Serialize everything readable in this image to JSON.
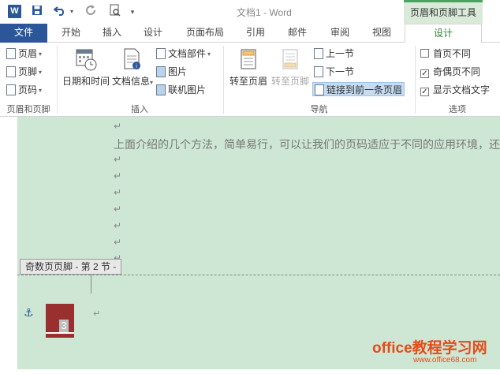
{
  "app": {
    "logo": "W",
    "window_title": "文档1 - Word",
    "context_header": "页眉和页脚工具"
  },
  "quick_access": {
    "save_icon": "save-icon",
    "undo_icon": "undo-icon",
    "redo_icon": "redo-icon",
    "preview_icon": "print-preview-icon",
    "customize_icon": "customize-icon"
  },
  "tabs": {
    "file": "文件",
    "home": "开始",
    "insert": "插入",
    "design_layout": "设计",
    "page_layout": "页面布局",
    "references": "引用",
    "mailings": "邮件",
    "review": "审阅",
    "view": "视图",
    "hf_design": "设计"
  },
  "ribbon": {
    "header_footer": {
      "header": "页眉",
      "footer": "页脚",
      "page_number": "页码",
      "label": "页眉和页脚"
    },
    "insert": {
      "date_time": "日期和时间",
      "doc_info": "文档信息",
      "quick_parts": "文档部件",
      "picture": "图片",
      "online_picture": "联机图片",
      "label": "插入"
    },
    "navigation": {
      "goto_header": "转至页眉",
      "goto_footer": "转至页脚",
      "previous": "上一节",
      "next": "下一节",
      "link_previous": "链接到前一条页眉",
      "label": "导航"
    },
    "options": {
      "different_first": "首页不同",
      "different_odd_even": "奇偶页不同",
      "show_doc_text": "显示文档文字",
      "different_first_checked": false,
      "different_odd_even_checked": true,
      "show_doc_text_checked": true,
      "label": "选项"
    }
  },
  "document": {
    "para_mark": "↵",
    "body_text": "上面介绍的几个方法，简单易行，可以让我们的页码适应于不同的应用环境，还",
    "footer_tag": "奇数页页脚 - 第 2 节 -",
    "page_number": "3",
    "watermark": "office教程学习网",
    "watermark_url": "www.office68.com"
  },
  "colors": {
    "word_blue": "#2b579a",
    "context_green": "#4aa564",
    "page_bg": "#cde7d4",
    "page_number_box": "#9a2f2f",
    "watermark": "#e54b1b"
  }
}
